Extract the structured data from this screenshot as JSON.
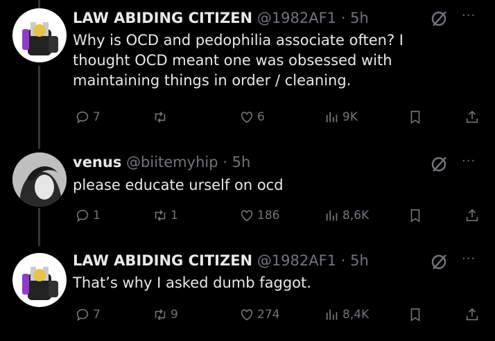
{
  "tweets": [
    {
      "name": "LAW ABIDING CITIZEN",
      "handle": "@1982AF1",
      "time": "· 5h",
      "text": "Why is OCD and pedophilia associate often? I thought OCD meant one was obsessed with maintaining things in order / cleaning.",
      "replies": "7",
      "retweets": "",
      "likes": "6",
      "views": "9K"
    },
    {
      "name": "venus",
      "handle": "@biitemyhip",
      "time": "· 5h",
      "text": "please educate urself on ocd",
      "replies": "1",
      "retweets": "1",
      "likes": "186",
      "views": "8,6K"
    },
    {
      "name": "LAW ABIDING CITIZEN",
      "handle": "@1982AF1",
      "time": "· 5h",
      "text": "That’s why I asked dumb faggot.",
      "replies": "7",
      "retweets": "9",
      "likes": "274",
      "views": "8,4K"
    }
  ],
  "icons": {
    "reply": "reply-icon",
    "retweet": "retweet-icon",
    "like": "heart-icon",
    "views": "views-icon",
    "bookmark": "bookmark-icon",
    "share": "share-icon",
    "grok": "grok-icon",
    "more": "more-icon"
  },
  "more_glyph": "···",
  "colors": {
    "background": "#000000",
    "text": "#e7e9ea",
    "muted": "#71767b",
    "thread": "#333639"
  }
}
